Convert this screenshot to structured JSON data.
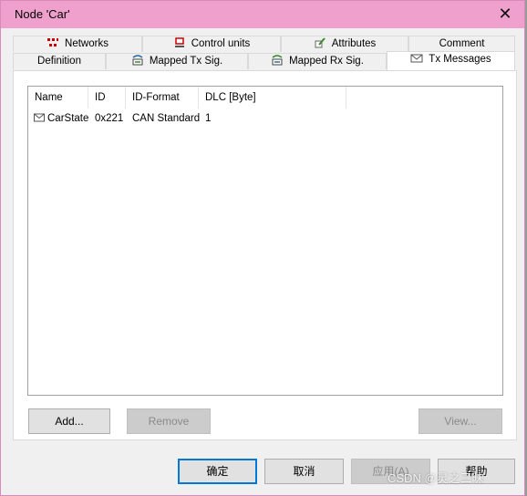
{
  "window": {
    "title": "Node 'Car'",
    "close_glyph": "✕"
  },
  "tabs_back": [
    {
      "label": "Networks",
      "icon": "networks-icon"
    },
    {
      "label": "Control units",
      "icon": "control-units-icon"
    },
    {
      "label": "Attributes",
      "icon": "attributes-icon"
    },
    {
      "label": "Comment",
      "icon": ""
    }
  ],
  "tabs_front": [
    {
      "label": "Definition",
      "icon": ""
    },
    {
      "label": "Mapped Tx Sig.",
      "icon": "mapped-tx-icon"
    },
    {
      "label": "Mapped Rx Sig.",
      "icon": "mapped-rx-icon"
    },
    {
      "label": "Tx Messages",
      "icon": "envelope-icon",
      "active": true
    }
  ],
  "list": {
    "columns": [
      "Name",
      "ID",
      "ID-Format",
      "DLC [Byte]"
    ],
    "rows": [
      {
        "name": "CarState",
        "id": "0x221",
        "format": "CAN Standard",
        "dlc": "1"
      }
    ]
  },
  "buttons": {
    "add": "Add...",
    "remove": "Remove",
    "view": "View...",
    "ok": "确定",
    "cancel": "取消",
    "apply": "应用(A)",
    "help": "帮助"
  },
  "watermark": "CSDN @灵之三昧"
}
